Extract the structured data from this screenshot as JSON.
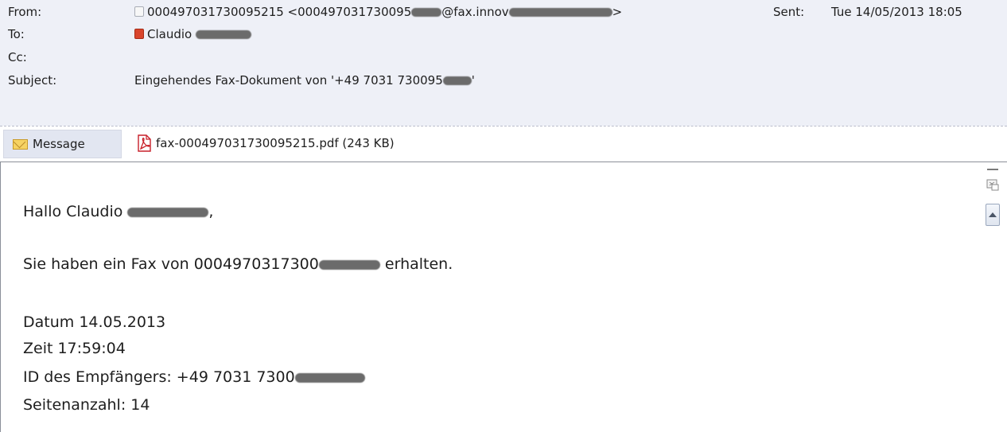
{
  "header": {
    "from_label": "From:",
    "from_prefix": "000497031730095215 <000497031730095",
    "from_mid": "@fax.innov",
    "from_suffix": ">",
    "to_label": "To:",
    "to_value": "Claudio",
    "cc_label": "Cc:",
    "subject_label": "Subject:",
    "subject_prefix": "Eingehendes Fax-Dokument von '+49 7031 730095",
    "subject_suffix": "'",
    "sent_label": "Sent:",
    "sent_value": "Tue 14/05/2013 18:05"
  },
  "tabs": {
    "message_label": "Message",
    "attachment_label": "fax-000497031730095215.pdf (243 KB)"
  },
  "body": {
    "greeting_prefix": "Hallo Claudio",
    "greeting_suffix": ",",
    "line_fax_prefix": "Sie haben ein Fax von 0004970317300",
    "line_fax_suffix": "erhalten.",
    "datum": "Datum 14.05.2013",
    "zeit": "Zeit 17:59:04",
    "empfaenger_prefix": "ID des Empfängers: +49 7031 7300",
    "seitenanzahl": "Seitenanzahl: 14"
  },
  "icons": {
    "from": "contact-icon",
    "to": "contact-icon",
    "message_tab": "envelope-icon",
    "attachment": "pdf-icon",
    "scroll_grip": "grip-icon",
    "scroll_up": "arrow-up-icon"
  },
  "colors": {
    "header_bg": "#eef0f7",
    "tab_bg": "#e2e6f1",
    "pdf_red": "#c8202a"
  }
}
